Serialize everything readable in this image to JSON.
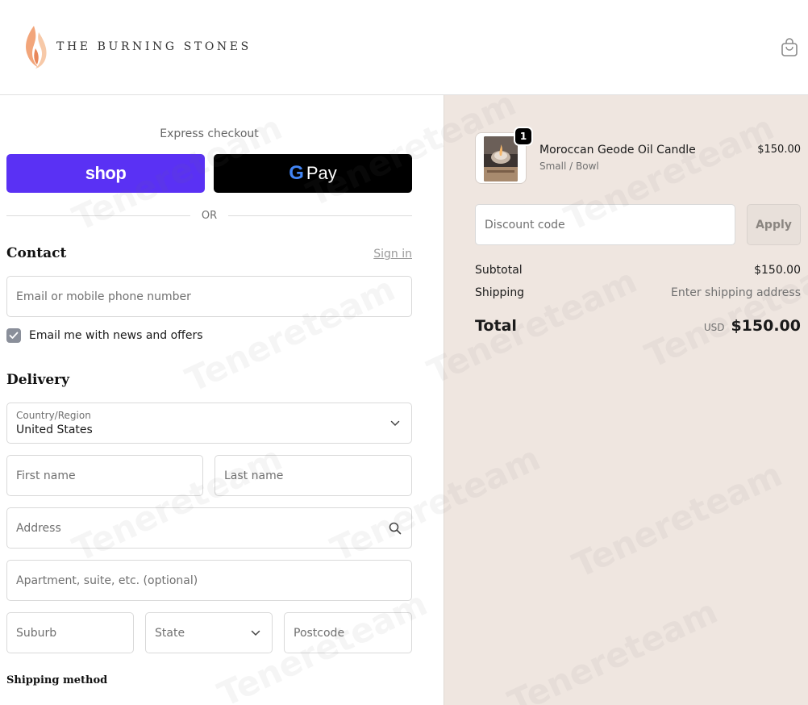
{
  "header": {
    "brand": "THE BURNING STONES"
  },
  "express": {
    "title": "Express checkout",
    "shop_label": "shop",
    "gpay_g": "G",
    "gpay_label": "Pay",
    "or_label": "OR"
  },
  "contact": {
    "title": "Contact",
    "sign_in": "Sign in",
    "email_placeholder": "Email or mobile phone number",
    "newsletter_label": "Email me with news and offers",
    "newsletter_checked": true
  },
  "delivery": {
    "title": "Delivery",
    "country_label": "Country/Region",
    "country_value": "United States",
    "first_name": "First name",
    "last_name": "Last name",
    "address": "Address",
    "apartment": "Apartment, suite, etc. (optional)",
    "suburb": "Suburb",
    "state": "State",
    "postcode": "Postcode"
  },
  "shipping": {
    "title": "Shipping method"
  },
  "summary": {
    "product": {
      "name": "Moroccan Geode Oil Candle",
      "variant": "Small / Bowl",
      "price": "$150.00",
      "quantity": "1"
    },
    "discount_placeholder": "Discount code",
    "apply_label": "Apply",
    "subtotal_label": "Subtotal",
    "subtotal_value": "$150.00",
    "shipping_label": "Shipping",
    "shipping_value": "Enter shipping address",
    "total_label": "Total",
    "total_currency": "USD",
    "total_value": "$150.00"
  },
  "watermark": {
    "text": "Tenereteam"
  },
  "colors": {
    "shop_purple": "#5a31f4",
    "gpay_black": "#000000",
    "summary_bg": "#efe6e0",
    "checkbox": "#8a8f9a"
  }
}
